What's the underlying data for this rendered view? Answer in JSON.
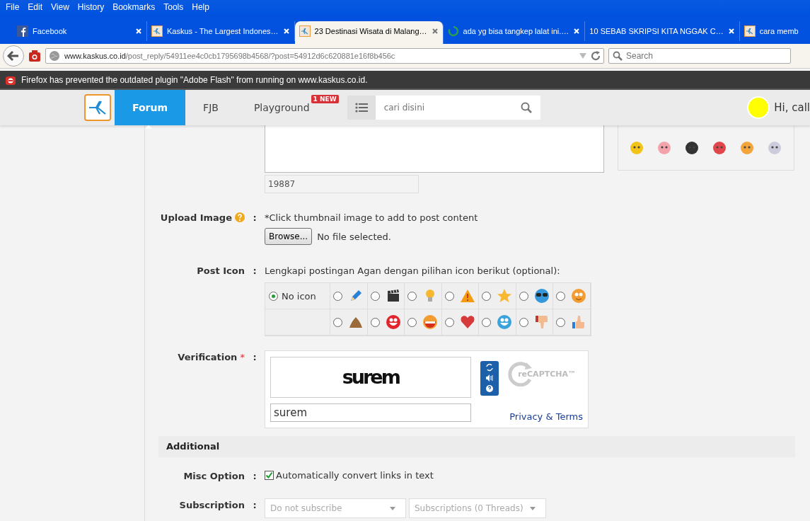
{
  "menu": [
    "File",
    "Edit",
    "View",
    "History",
    "Bookmarks",
    "Tools",
    "Help"
  ],
  "tabs": [
    {
      "title": "Facebook",
      "selected": false,
      "loading": false,
      "closable": true
    },
    {
      "title": "Kaskus - The Largest Indones…",
      "selected": false,
      "loading": false,
      "closable": true
    },
    {
      "title": "23 Destinasi Wisata di Malang…",
      "selected": true,
      "loading": false,
      "closable": true
    },
    {
      "title": "ada yg bisa tangkep lalat ini.…",
      "selected": false,
      "loading": true,
      "closable": true
    },
    {
      "title": "10 SEBAB SKRIPSI KITA NGGAK C…",
      "selected": false,
      "loading": false,
      "closable": true
    },
    {
      "title": "cara memb",
      "selected": false,
      "loading": false,
      "closable": false
    }
  ],
  "address": {
    "host": "www.kaskus.co.id",
    "path": "/post_reply/54911ee4c0cb1795698b4568/?post=54912d6c620881e16f8b456c"
  },
  "browser_search": {
    "placeholder": "Search"
  },
  "notification": "Firefox has prevented the outdated plugin \"Adobe Flash\" from running on www.kaskus.co.id.",
  "site_nav": [
    {
      "label": "Forum",
      "selected": true
    },
    {
      "label": "FJB",
      "selected": false
    },
    {
      "label": "Playground",
      "selected": false,
      "badge": "1 NEW"
    }
  ],
  "site_search": {
    "placeholder": "cari disini"
  },
  "user_greeting": "Hi, call",
  "char_counter": "19887",
  "upload": {
    "label": "Upload Image",
    "colon": ":",
    "hint": "*Click thumbnail image to add to post content",
    "button": "Browse...",
    "status": "No file selected."
  },
  "post_icon": {
    "label": "Post Icon",
    "colon": ":",
    "hint": "Lengkapi postingan Agan dengan pilihan icon berikut (optional):",
    "options": [
      {
        "label": "No icon",
        "selected": true
      },
      {
        "selected": false
      },
      {
        "selected": false
      },
      {
        "selected": false
      },
      {
        "selected": false
      },
      {
        "selected": false
      },
      {
        "selected": false
      },
      {
        "selected": false
      },
      {
        "selected": false
      },
      {
        "selected": false
      },
      {
        "selected": false
      },
      {
        "selected": false
      },
      {
        "selected": false
      },
      {
        "selected": false
      },
      {
        "selected": false
      }
    ]
  },
  "verification": {
    "label": "Verification",
    "colon": ":",
    "required_mark": "*",
    "captcha_text": "surem",
    "value": "surem",
    "brand": "reCAPTCHA™",
    "link": "Privacy & Terms"
  },
  "additional": {
    "title": "Additional",
    "misc": {
      "label": "Misc Option",
      "colon": ":",
      "checked": true,
      "text": "Automatically convert links in text"
    },
    "subscription": {
      "label": "Subscription",
      "colon": ":",
      "selects": [
        "Do not subscribe",
        "Subscriptions (0 Threads)"
      ]
    }
  }
}
